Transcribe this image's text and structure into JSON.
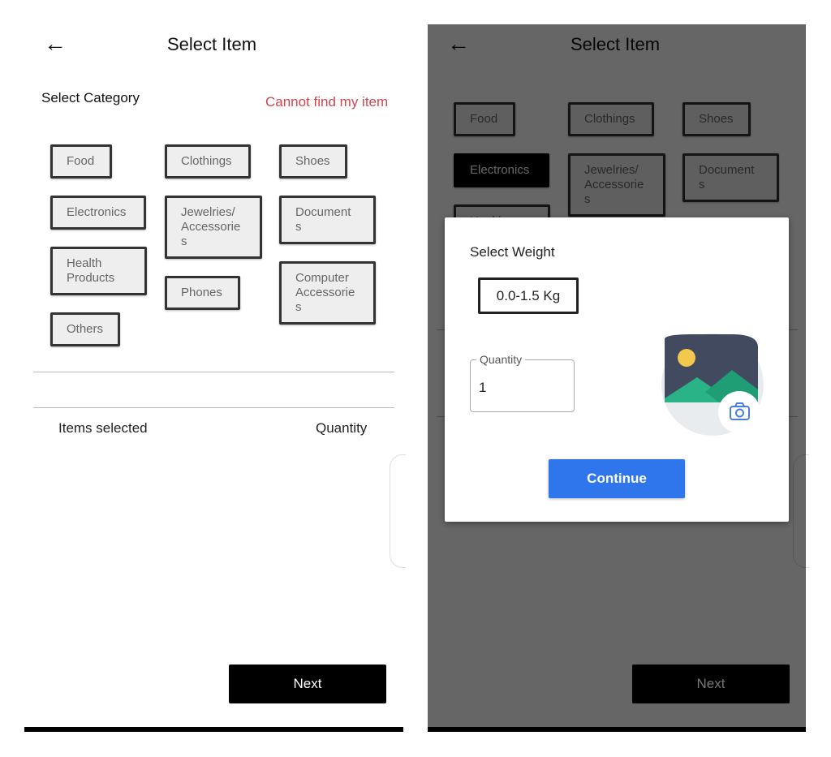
{
  "header": {
    "title": "Select Item",
    "back_icon": "arrow-left-icon"
  },
  "section": {
    "label": "Select Category",
    "cannot_find_link": "Cannot find my item"
  },
  "categories": [
    {
      "label": "Food"
    },
    {
      "label": "Clothings"
    },
    {
      "label": "Shoes"
    },
    {
      "label": "Electronics"
    },
    {
      "label": "Jewelries/\nAccessorie\ns"
    },
    {
      "label": "Document\ns"
    },
    {
      "label": "Health\nProducts"
    },
    {
      "label": "Phones"
    },
    {
      "label": "Computer\nAccessorie\ns"
    },
    {
      "label": "Others"
    }
  ],
  "selected_category_right": "Electronics",
  "list": {
    "items_header": "Items selected",
    "quantity_header": "Quantity"
  },
  "next_label": "Next",
  "dialog": {
    "title": "Select Weight",
    "weight_option": "0.0-1.5 Kg",
    "quantity_label": "Quantity",
    "quantity_value": "1",
    "image_icon": "image-placeholder-icon",
    "camera_icon": "camera-icon",
    "continue_label": "Continue"
  },
  "colors": {
    "link_red": "#d0454c",
    "continue_blue": "#2f76ec",
    "overlay_gray": "#666666"
  }
}
